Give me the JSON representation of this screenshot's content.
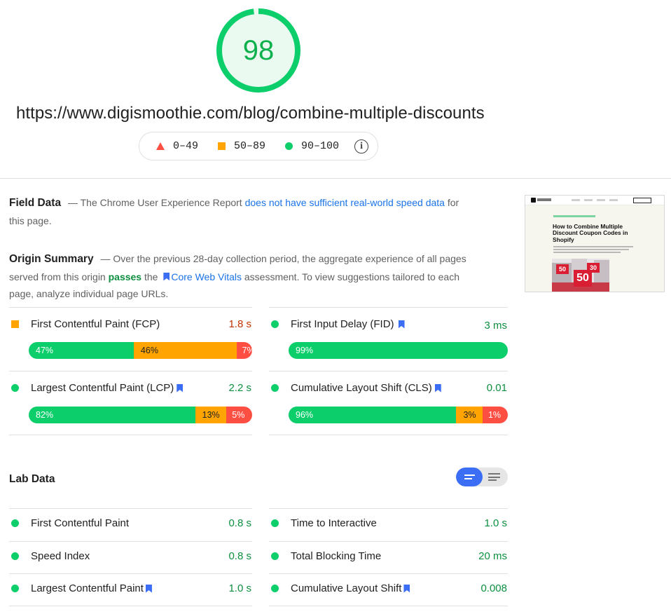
{
  "score": {
    "value": "98",
    "color": "#0cce6b"
  },
  "url": "https://www.digismoothie.com/blog/combine-multiple-discounts",
  "legend": {
    "ranges": [
      {
        "label": "0–49",
        "shape": "triangle",
        "color": "#ff4e42"
      },
      {
        "label": "50–89",
        "shape": "square",
        "color": "#ffa400"
      },
      {
        "label": "90–100",
        "shape": "circle",
        "color": "#0cce6b"
      }
    ],
    "info_icon": "info-icon"
  },
  "field_data": {
    "heading": "Field Data",
    "text_before": "— The Chrome User Experience Report ",
    "link_text": "does not have sufficient real-world speed data",
    "text_after": " for this page."
  },
  "origin_summary": {
    "heading": "Origin Summary",
    "text_1": "— Over the previous 28-day collection period, the aggregate experience of all pages served from this origin ",
    "passes": "passes",
    "text_2": " the ",
    "cwv_link": "Core Web Vitals",
    "text_3": " assessment. To view suggestions tailored to each page, analyze individual page URLs."
  },
  "thumbnail": {
    "title": "How to Combine Multiple Discount Coupon Codes in Shopify",
    "sign_1": "50",
    "sign_2": "30",
    "sign_3": "50"
  },
  "origin_metrics": [
    {
      "name": "First Contentful Paint (FCP)",
      "value": "1.8 s",
      "status": "average",
      "bookmark": false,
      "dist": [
        "47%",
        "46%",
        "7%"
      ],
      "fractions": [
        0.47,
        0.46,
        0.07
      ]
    },
    {
      "name": "First Input Delay (FID)",
      "value": "3 ms",
      "status": "pass",
      "bookmark": true,
      "dist": [
        "99%",
        "",
        ""
      ],
      "fractions": [
        1.0,
        0,
        0
      ]
    },
    {
      "name": "Largest Contentful Paint (LCP)",
      "value": "2.2 s",
      "status": "pass",
      "bookmark": true,
      "dist": [
        "82%",
        "13%",
        "5%"
      ],
      "fractions": [
        0.745,
        0.14,
        0.115
      ]
    },
    {
      "name": "Cumulative Layout Shift (CLS)",
      "value": "0.01",
      "status": "pass",
      "bookmark": true,
      "dist": [
        "96%",
        "3%",
        "1%"
      ],
      "fractions": [
        0.765,
        0.12,
        0.115
      ]
    }
  ],
  "lab_data": {
    "heading": "Lab Data",
    "metrics": [
      {
        "name": "First Contentful Paint",
        "value": "0.8 s",
        "bookmark": false
      },
      {
        "name": "Time to Interactive",
        "value": "1.0 s",
        "bookmark": false
      },
      {
        "name": "Speed Index",
        "value": "0.8 s",
        "bookmark": false
      },
      {
        "name": "Total Blocking Time",
        "value": "20 ms",
        "bookmark": false
      },
      {
        "name": "Largest Contentful Paint",
        "value": "1.0 s",
        "bookmark": true
      },
      {
        "name": "Cumulative Layout Shift",
        "value": "0.008",
        "bookmark": true
      }
    ]
  },
  "colors": {
    "pass": "#0cce6b",
    "average": "#ffa400",
    "fail": "#ff4e42",
    "link": "#1a73e8",
    "toggle": "#3b6ef5"
  }
}
